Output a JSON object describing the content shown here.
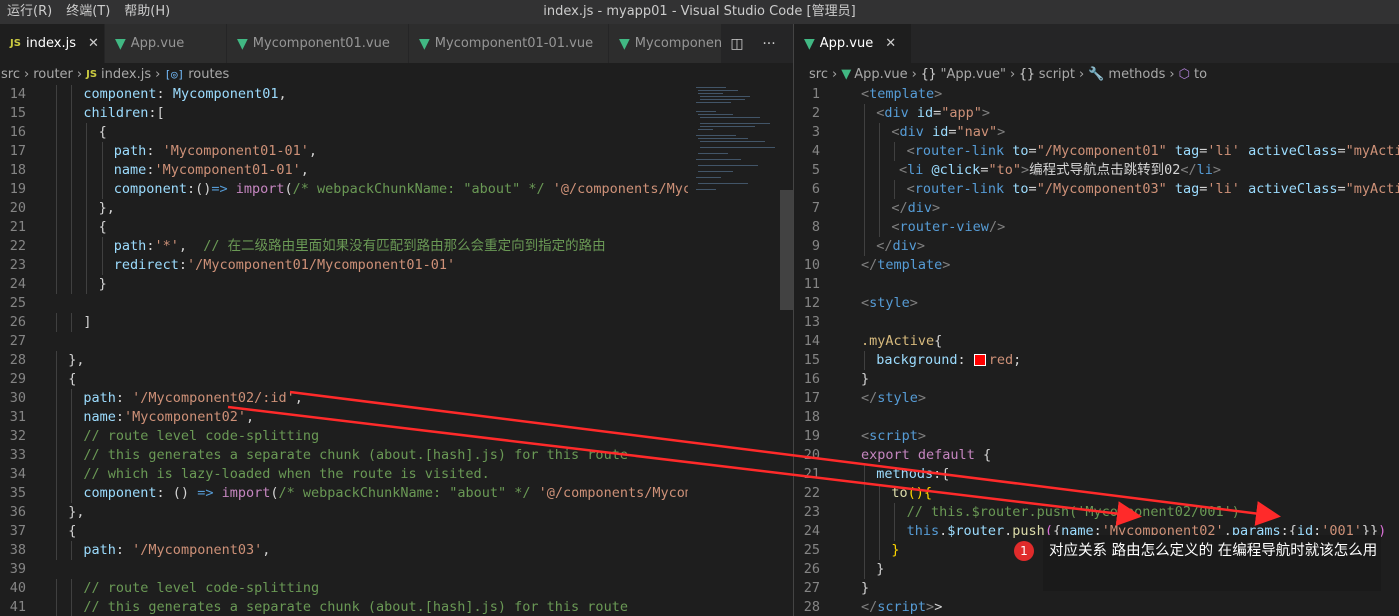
{
  "menu": [
    "运行(R)",
    "终端(T)",
    "帮助(H)"
  ],
  "window_title": "index.js - myapp01 - Visual Studio Code [管理员]",
  "left_tabs": [
    {
      "label": "index.js",
      "icon": "JS",
      "active": true,
      "close": "✕"
    },
    {
      "label": "App.vue",
      "icon": "V",
      "active": false
    },
    {
      "label": "Mycomponent01.vue",
      "icon": "V",
      "active": false
    },
    {
      "label": "Mycomponent01-01.vue",
      "icon": "V",
      "active": false
    },
    {
      "label": "Mycomponen",
      "icon": "V",
      "active": false
    }
  ],
  "left_actions": [
    "◫",
    "···"
  ],
  "right_tabs": [
    {
      "label": "App.vue",
      "icon": "V",
      "active": true,
      "close": "✕"
    }
  ],
  "left_breadcrumb": [
    "src",
    "router",
    "index.js",
    "routes"
  ],
  "right_breadcrumb": [
    "src",
    "App.vue",
    "\"App.vue\"",
    "script",
    "methods",
    "to"
  ],
  "left_lines": [
    {
      "n": "14",
      "indent": 4,
      "tokens": [
        [
          "p",
          "component"
        ],
        [
          "w",
          ": "
        ],
        [
          "p",
          "Mycomponent01"
        ],
        [
          "w",
          ","
        ]
      ]
    },
    {
      "n": "15",
      "indent": 4,
      "tokens": [
        [
          "p",
          "children"
        ],
        [
          "w",
          ":["
        ]
      ]
    },
    {
      "n": "16",
      "indent": 6,
      "tokens": [
        [
          "w",
          "{"
        ]
      ]
    },
    {
      "n": "17",
      "indent": 8,
      "tokens": [
        [
          "p",
          "path"
        ],
        [
          "w",
          ": "
        ],
        [
          "s",
          "'Mycomponent01-01'"
        ],
        [
          "w",
          ","
        ]
      ]
    },
    {
      "n": "18",
      "indent": 8,
      "tokens": [
        [
          "p",
          "name"
        ],
        [
          "w",
          ":"
        ],
        [
          "s",
          "'Mycomponent01-01'"
        ],
        [
          "w",
          ","
        ]
      ]
    },
    {
      "n": "19",
      "indent": 8,
      "tokens": [
        [
          "p",
          "component"
        ],
        [
          "w",
          ":()"
        ],
        [
          "k",
          "=>"
        ],
        [
          "w",
          " "
        ],
        [
          "kw",
          "import"
        ],
        [
          "w",
          "("
        ],
        [
          "c",
          "/* webpackChunkName: \"about\" */"
        ],
        [
          "w",
          " "
        ],
        [
          "s",
          "'@/components/Mycompo"
        ]
      ]
    },
    {
      "n": "20",
      "indent": 6,
      "tokens": [
        [
          "w",
          "},"
        ]
      ]
    },
    {
      "n": "21",
      "indent": 6,
      "tokens": [
        [
          "w",
          "{"
        ]
      ]
    },
    {
      "n": "22",
      "indent": 8,
      "tokens": [
        [
          "p",
          "path"
        ],
        [
          "w",
          ":"
        ],
        [
          "s",
          "'*'"
        ],
        [
          "w",
          ",  "
        ],
        [
          "c",
          "// 在二级路由里面如果没有匹配到路由那么会重定向到指定的路由"
        ]
      ]
    },
    {
      "n": "23",
      "indent": 8,
      "tokens": [
        [
          "p",
          "redirect"
        ],
        [
          "w",
          ":"
        ],
        [
          "s",
          "'/Mycomponent01/Mycomponent01-01'"
        ]
      ]
    },
    {
      "n": "24",
      "indent": 6,
      "tokens": [
        [
          "w",
          "}"
        ]
      ]
    },
    {
      "n": "25",
      "indent": 0,
      "tokens": []
    },
    {
      "n": "26",
      "indent": 4,
      "tokens": [
        [
          "w",
          "]"
        ]
      ]
    },
    {
      "n": "27",
      "indent": 0,
      "tokens": []
    },
    {
      "n": "28",
      "indent": 2,
      "tokens": [
        [
          "w",
          "},"
        ]
      ]
    },
    {
      "n": "29",
      "indent": 2,
      "tokens": [
        [
          "w",
          "{"
        ]
      ]
    },
    {
      "n": "30",
      "indent": 4,
      "tokens": [
        [
          "p",
          "path"
        ],
        [
          "w",
          ": "
        ],
        [
          "s",
          "'/Mycomponent02/:id'"
        ],
        [
          "w",
          ","
        ]
      ]
    },
    {
      "n": "31",
      "indent": 4,
      "tokens": [
        [
          "p",
          "name"
        ],
        [
          "w",
          ":"
        ],
        [
          "s",
          "'Mycomponent02'"
        ],
        [
          "w",
          ","
        ]
      ]
    },
    {
      "n": "32",
      "indent": 4,
      "tokens": [
        [
          "c",
          "// route level code-splitting"
        ]
      ]
    },
    {
      "n": "33",
      "indent": 4,
      "tokens": [
        [
          "c",
          "// this generates a separate chunk (about.[hash].js) for this route"
        ]
      ]
    },
    {
      "n": "34",
      "indent": 4,
      "tokens": [
        [
          "c",
          "// which is lazy-loaded when the route is visited."
        ]
      ]
    },
    {
      "n": "35",
      "indent": 4,
      "tokens": [
        [
          "p",
          "component"
        ],
        [
          "w",
          ": () "
        ],
        [
          "k",
          "=>"
        ],
        [
          "w",
          " "
        ],
        [
          "kw",
          "import"
        ],
        [
          "w",
          "("
        ],
        [
          "c",
          "/* webpackChunkName: \"about\" */"
        ],
        [
          "w",
          " "
        ],
        [
          "s",
          "'@/components/Mycompone"
        ]
      ]
    },
    {
      "n": "36",
      "indent": 2,
      "tokens": [
        [
          "w",
          "},"
        ]
      ]
    },
    {
      "n": "37",
      "indent": 2,
      "tokens": [
        [
          "w",
          "{"
        ]
      ]
    },
    {
      "n": "38",
      "indent": 4,
      "tokens": [
        [
          "p",
          "path"
        ],
        [
          "w",
          ": "
        ],
        [
          "s",
          "'/Mycomponent03'"
        ],
        [
          "w",
          ","
        ]
      ]
    },
    {
      "n": "39",
      "indent": 0,
      "tokens": []
    },
    {
      "n": "40",
      "indent": 4,
      "tokens": [
        [
          "c",
          "// route level code-splitting"
        ]
      ]
    },
    {
      "n": "41",
      "indent": 4,
      "tokens": [
        [
          "c",
          "// this generates a separate chunk (about.[hash].js) for this route"
        ]
      ]
    }
  ],
  "right_lines": [
    {
      "n": "1",
      "indent": 0,
      "tokens": [
        [
          "g",
          "<"
        ],
        [
          "t",
          "template"
        ],
        [
          "g",
          ">"
        ]
      ]
    },
    {
      "n": "2",
      "indent": 2,
      "tokens": [
        [
          "g",
          "<"
        ],
        [
          "t",
          "div"
        ],
        [
          "w",
          " "
        ],
        [
          "a",
          "id"
        ],
        [
          "w",
          "="
        ],
        [
          "s",
          "\"app\""
        ],
        [
          "g",
          ">"
        ]
      ]
    },
    {
      "n": "3",
      "indent": 4,
      "tokens": [
        [
          "g",
          "<"
        ],
        [
          "t",
          "div"
        ],
        [
          "w",
          " "
        ],
        [
          "a",
          "id"
        ],
        [
          "w",
          "="
        ],
        [
          "s",
          "\"nav\""
        ],
        [
          "g",
          ">"
        ]
      ]
    },
    {
      "n": "4",
      "indent": 6,
      "tokens": [
        [
          "g",
          "<"
        ],
        [
          "t",
          "router-link"
        ],
        [
          "w",
          " "
        ],
        [
          "a",
          "to"
        ],
        [
          "w",
          "="
        ],
        [
          "s",
          "\"/Mycomponent01\""
        ],
        [
          "w",
          " "
        ],
        [
          "a",
          "tag"
        ],
        [
          "w",
          "="
        ],
        [
          "s",
          "'li'"
        ],
        [
          "w",
          " "
        ],
        [
          "a",
          "activeClass"
        ],
        [
          "w",
          "="
        ],
        [
          "s",
          "\"myActive\""
        ]
      ]
    },
    {
      "n": "5",
      "indent": 5,
      "tokens": [
        [
          "g",
          "<"
        ],
        [
          "t",
          "li"
        ],
        [
          "w",
          " "
        ],
        [
          "a",
          "@click"
        ],
        [
          "w",
          "="
        ],
        [
          "s",
          "\"to\""
        ],
        [
          "g",
          ">"
        ],
        [
          "w",
          "编程式导航点击跳转到02"
        ],
        [
          "g",
          "</"
        ],
        [
          "t",
          "li"
        ],
        [
          "g",
          ">"
        ]
      ]
    },
    {
      "n": "6",
      "indent": 6,
      "tokens": [
        [
          "g",
          "<"
        ],
        [
          "t",
          "router-link"
        ],
        [
          "w",
          " "
        ],
        [
          "a",
          "to"
        ],
        [
          "w",
          "="
        ],
        [
          "s",
          "\"/Mycomponent03\""
        ],
        [
          "w",
          " "
        ],
        [
          "a",
          "tag"
        ],
        [
          "w",
          "="
        ],
        [
          "s",
          "'li'"
        ],
        [
          "w",
          " "
        ],
        [
          "a",
          "activeClass"
        ],
        [
          "w",
          "="
        ],
        [
          "s",
          "\"myActive\""
        ]
      ]
    },
    {
      "n": "7",
      "indent": 4,
      "tokens": [
        [
          "g",
          "</"
        ],
        [
          "t",
          "div"
        ],
        [
          "g",
          ">"
        ]
      ]
    },
    {
      "n": "8",
      "indent": 4,
      "tokens": [
        [
          "g",
          "<"
        ],
        [
          "t",
          "router-view"
        ],
        [
          "g",
          "/>"
        ]
      ]
    },
    {
      "n": "9",
      "indent": 2,
      "tokens": [
        [
          "g",
          "</"
        ],
        [
          "t",
          "div"
        ],
        [
          "g",
          ">"
        ]
      ]
    },
    {
      "n": "10",
      "indent": 0,
      "tokens": [
        [
          "g",
          "</"
        ],
        [
          "t",
          "template"
        ],
        [
          "g",
          ">"
        ]
      ]
    },
    {
      "n": "11",
      "indent": 0,
      "tokens": []
    },
    {
      "n": "12",
      "indent": 0,
      "tokens": [
        [
          "g",
          "<"
        ],
        [
          "t",
          "style"
        ],
        [
          "g",
          ">"
        ]
      ]
    },
    {
      "n": "13",
      "indent": 0,
      "tokens": []
    },
    {
      "n": "14",
      "indent": 0,
      "tokens": [
        [
          "cls",
          ".myActive"
        ],
        [
          "w",
          "{"
        ]
      ]
    },
    {
      "n": "15",
      "indent": 2,
      "tokens": [
        [
          "p",
          "background"
        ],
        [
          "w",
          ": "
        ],
        [
          "swatch",
          ""
        ],
        [
          "s",
          "red"
        ],
        [
          "w",
          ";"
        ]
      ]
    },
    {
      "n": "16",
      "indent": 0,
      "tokens": [
        [
          "w",
          "}"
        ]
      ]
    },
    {
      "n": "17",
      "indent": 0,
      "tokens": [
        [
          "g",
          "</"
        ],
        [
          "t",
          "style"
        ],
        [
          "g",
          ">"
        ]
      ]
    },
    {
      "n": "18",
      "indent": 0,
      "tokens": []
    },
    {
      "n": "19",
      "indent": 0,
      "tokens": [
        [
          "g",
          "<"
        ],
        [
          "t",
          "script"
        ],
        [
          "g",
          ">"
        ]
      ]
    },
    {
      "n": "20",
      "indent": 0,
      "tokens": [
        [
          "kw",
          "export"
        ],
        [
          "w",
          " "
        ],
        [
          "kw",
          "default"
        ],
        [
          "w",
          " {"
        ]
      ]
    },
    {
      "n": "21",
      "indent": 2,
      "tokens": [
        [
          "p",
          "methods"
        ],
        [
          "w",
          ":{"
        ]
      ]
    },
    {
      "n": "22",
      "indent": 4,
      "tokens": [
        [
          "f",
          "to"
        ],
        [
          "y",
          "()"
        ],
        [
          "y",
          "{"
        ]
      ]
    },
    {
      "n": "23",
      "indent": 6,
      "tokens": [
        [
          "c",
          "// this.$router.push('Mycomponent02/001')"
        ]
      ]
    },
    {
      "n": "24",
      "indent": 6,
      "tokens": [
        [
          "k",
          "this"
        ],
        [
          "w",
          "."
        ],
        [
          "p",
          "$router"
        ],
        [
          "w",
          "."
        ],
        [
          "f",
          "push"
        ],
        [
          "pk",
          "("
        ],
        [
          "w",
          "{"
        ],
        [
          "p",
          "name"
        ],
        [
          "w",
          ":"
        ],
        [
          "s",
          "'Mycomponent02'"
        ],
        [
          "w",
          ","
        ],
        [
          "p",
          "params"
        ],
        [
          "w",
          ":{"
        ],
        [
          "p",
          "id"
        ],
        [
          "w",
          ":"
        ],
        [
          "s",
          "'001'"
        ],
        [
          "w",
          "}}"
        ],
        [
          "pk",
          ")"
        ]
      ]
    },
    {
      "n": "25",
      "indent": 4,
      "tokens": [
        [
          "y",
          "}"
        ]
      ]
    },
    {
      "n": "26",
      "indent": 2,
      "tokens": [
        [
          "w",
          "}"
        ]
      ]
    },
    {
      "n": "27",
      "indent": 0,
      "tokens": [
        [
          "w",
          "}"
        ]
      ]
    },
    {
      "n": "28",
      "indent": 0,
      "tokens": [
        [
          "g",
          "</"
        ],
        [
          "t",
          "script"
        ],
        [
          "g",
          ">"
        ],
        [
          "w",
          ">"
        ]
      ]
    }
  ],
  "callout": {
    "number": "1",
    "text": "对应关系 路由怎么定义的 在编程导航时就该怎么用"
  },
  "colors": {
    "accent_red": "#ff2a2a",
    "editor_bg": "#1e1e1e",
    "vue_green": "#41b883"
  }
}
